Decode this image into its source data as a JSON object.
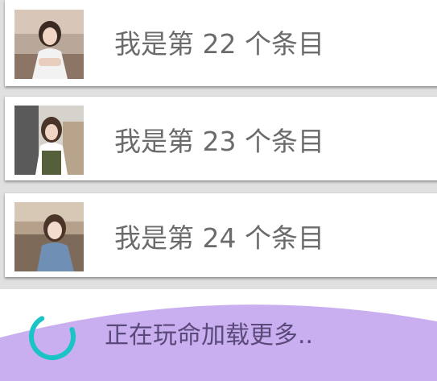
{
  "items": [
    {
      "label": "我是第 22 个条目"
    },
    {
      "label": "我是第 23 个条目"
    },
    {
      "label": "我是第 24 个条目"
    }
  ],
  "footer": {
    "loading_text": "正在玩命加载更多.."
  },
  "colors": {
    "wave": "#c9aef0",
    "spinner": "#19c3c6",
    "label": "#6b6b6b"
  },
  "icons": {
    "spinner": "loading-spinner-icon",
    "thumbnail": "photo-thumbnail"
  }
}
